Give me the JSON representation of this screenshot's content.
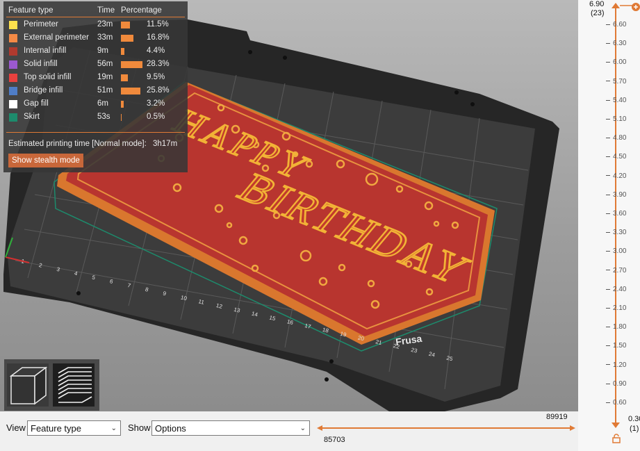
{
  "legend": {
    "header": {
      "feature_type": "Feature type",
      "time": "Time",
      "percentage": "Percentage"
    },
    "rows": [
      {
        "name": "Perimeter",
        "time": "23m",
        "pct": "11.5%",
        "value": 11.5,
        "color": "#ffe14d"
      },
      {
        "name": "External perimeter",
        "time": "33m",
        "pct": "16.8%",
        "value": 16.8,
        "color": "#f58a45"
      },
      {
        "name": "Internal infill",
        "time": "9m",
        "pct": "4.4%",
        "value": 4.4,
        "color": "#b03a2e"
      },
      {
        "name": "Solid infill",
        "time": "56m",
        "pct": "28.3%",
        "value": 28.3,
        "color": "#9b59d0"
      },
      {
        "name": "Top solid infill",
        "time": "19m",
        "pct": "9.5%",
        "value": 9.5,
        "color": "#e8413e"
      },
      {
        "name": "Bridge infill",
        "time": "51m",
        "pct": "25.8%",
        "value": 25.8,
        "color": "#4f7dc7"
      },
      {
        "name": "Gap fill",
        "time": "6m",
        "pct": "3.2%",
        "value": 3.2,
        "color": "#ffffff"
      },
      {
        "name": "Skirt",
        "time": "53s",
        "pct": "0.5%",
        "value": 0.5,
        "color": "#1d8b6c"
      }
    ],
    "estimate_label": "Estimated printing time [Normal mode]:",
    "estimate_value": "3h17m",
    "stealth_button": "Show stealth mode"
  },
  "bed": {
    "text_lines": [
      "HAPPY",
      "BIRTHDAY"
    ],
    "brand": "Frusa",
    "axis_numbers": [
      "1",
      "2",
      "3",
      "4",
      "5",
      "6",
      "7",
      "8",
      "9",
      "10",
      "11",
      "12",
      "13",
      "14",
      "15",
      "16",
      "17",
      "18",
      "19",
      "20",
      "21",
      "22",
      "23",
      "24",
      "25"
    ]
  },
  "bottom": {
    "view_label": "View",
    "view_value": "Feature type",
    "show_label": "Show",
    "show_value": "Options"
  },
  "hslider": {
    "top_value": "89919",
    "bottom_value": "85703"
  },
  "vslider": {
    "top_value": "6.90",
    "top_layer": "(23)",
    "bottom_value": "0.30",
    "bottom_layer": "(1)",
    "ticks": [
      "6.60",
      "6.30",
      "6.00",
      "5.70",
      "5.40",
      "5.10",
      "4.80",
      "4.50",
      "4.20",
      "3.90",
      "3.60",
      "3.30",
      "3.00",
      "2.70",
      "2.40",
      "2.10",
      "1.80",
      "1.50",
      "1.20",
      "0.90",
      "0.60"
    ]
  },
  "colors": {
    "accent": "#e07a35",
    "plate_red": "#b8352f",
    "plate_orange": "#d9772e",
    "bed": "#2e2e2e"
  }
}
